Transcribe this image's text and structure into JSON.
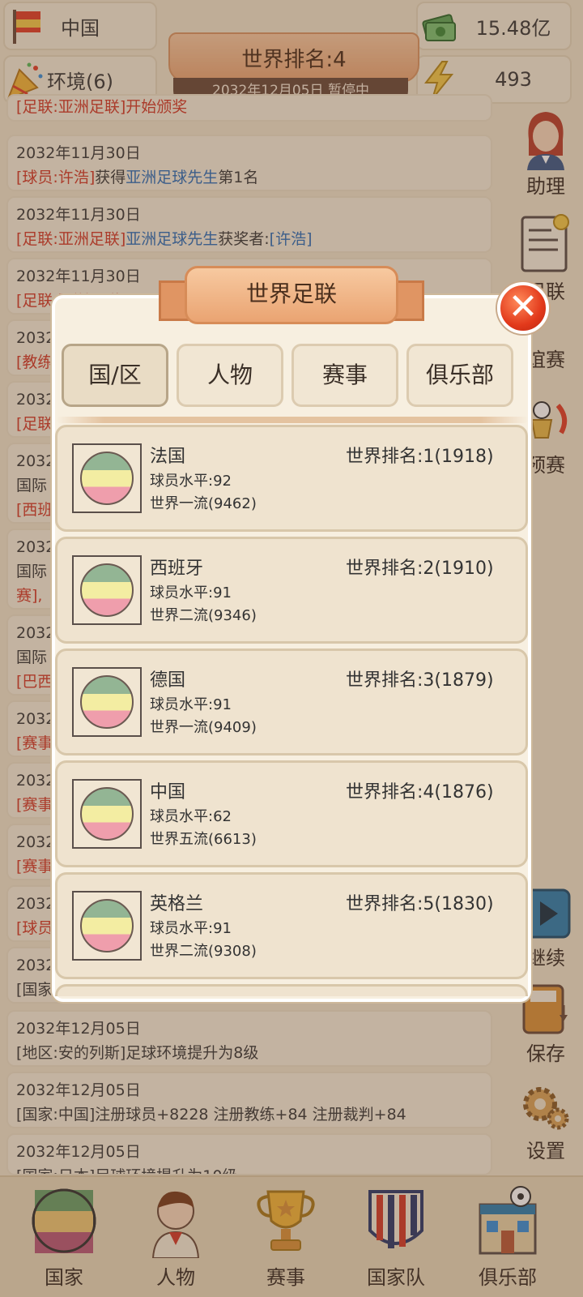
{
  "top": {
    "country": "中国",
    "money": "15.48亿",
    "environment": "环境(6)",
    "energy": "493",
    "world_rank": "世界排名:4",
    "date_status": "2032年12月05日  暂停中"
  },
  "feed": [
    {
      "partial": "[足联:亚洲足联]开始颁奖"
    },
    {
      "date": "2032年11月30日",
      "a": "[球员:许浩]",
      "b": "获得",
      "c": "亚洲足球先生",
      "d": "第1名"
    },
    {
      "date": "2032年11月30日",
      "a": "[足联:亚洲足联]",
      "c": "亚洲足球先生",
      "d": "获奖者:",
      "e": "[许浩]"
    },
    {
      "date": "2032年11月30日",
      "a": "[足联:亚洲足联]"
    },
    {
      "date": "2032",
      "a": "[教练"
    },
    {
      "date": "2032",
      "a": "[足联"
    },
    {
      "date": "2032",
      "b": "国际",
      "a": "[西班"
    },
    {
      "date": "2032",
      "b": "国际",
      "a": "赛],"
    },
    {
      "date": "2032",
      "b": "国际",
      "a": "[巴西"
    },
    {
      "date": "2032",
      "a": "[赛事"
    },
    {
      "date": "2032",
      "a": "[赛事"
    },
    {
      "date": "2032",
      "a": "[赛事"
    },
    {
      "date": "2032",
      "a": "[球员"
    },
    {
      "date": "2032",
      "b": "[国家"
    },
    {
      "date": "2032年12月05日",
      "b": "[地区:安的列斯]足球环境提升为8级"
    },
    {
      "date": "2032年12月05日",
      "b": "[国家:中国]注册球员+8228  注册教练+84  注册裁判+84"
    },
    {
      "date": "2032年12月05日",
      "b": "[国家:日本]足球环境提升为10级"
    }
  ],
  "side_menu": {
    "assistant": "助理",
    "federation": "足联",
    "friendly": "谊赛",
    "qualifiers": "预赛",
    "continue": "继续",
    "save": "保存",
    "settings": "设置"
  },
  "bottom_nav": [
    "国家",
    "人物",
    "赛事",
    "国家队",
    "俱乐部"
  ],
  "modal": {
    "title": "世界足联",
    "close": "✕",
    "tabs": [
      "国/区",
      "人物",
      "赛事",
      "俱乐部"
    ],
    "active_tab": 0,
    "countries": [
      {
        "name": "法国",
        "rank": "世界排名:1(1918)",
        "level": "球员水平:92",
        "tier": "世界一流(9462)"
      },
      {
        "name": "西班牙",
        "rank": "世界排名:2(1910)",
        "level": "球员水平:91",
        "tier": "世界二流(9346)"
      },
      {
        "name": "德国",
        "rank": "世界排名:3(1879)",
        "level": "球员水平:91",
        "tier": "世界一流(9409)"
      },
      {
        "name": "中国",
        "rank": "世界排名:4(1876)",
        "level": "球员水平:62",
        "tier": "世界五流(6613)"
      },
      {
        "name": "英格兰",
        "rank": "世界排名:5(1830)",
        "level": "球员水平:91",
        "tier": "世界二流(9308)"
      }
    ]
  },
  "colors": {
    "accent_red": "#d23b2c",
    "accent_blue": "#2f6fb8",
    "ribbon": "#eaa472",
    "panel": "#f7efe0"
  },
  "icons": [
    "flag-icon",
    "money-icon",
    "party-popper-icon",
    "lightning-icon",
    "assistant-icon",
    "federation-icon",
    "play-icon",
    "save-icon",
    "gear-icon",
    "country-flag-icon",
    "person-icon",
    "trophy-icon",
    "national-team-icon",
    "club-icon"
  ]
}
